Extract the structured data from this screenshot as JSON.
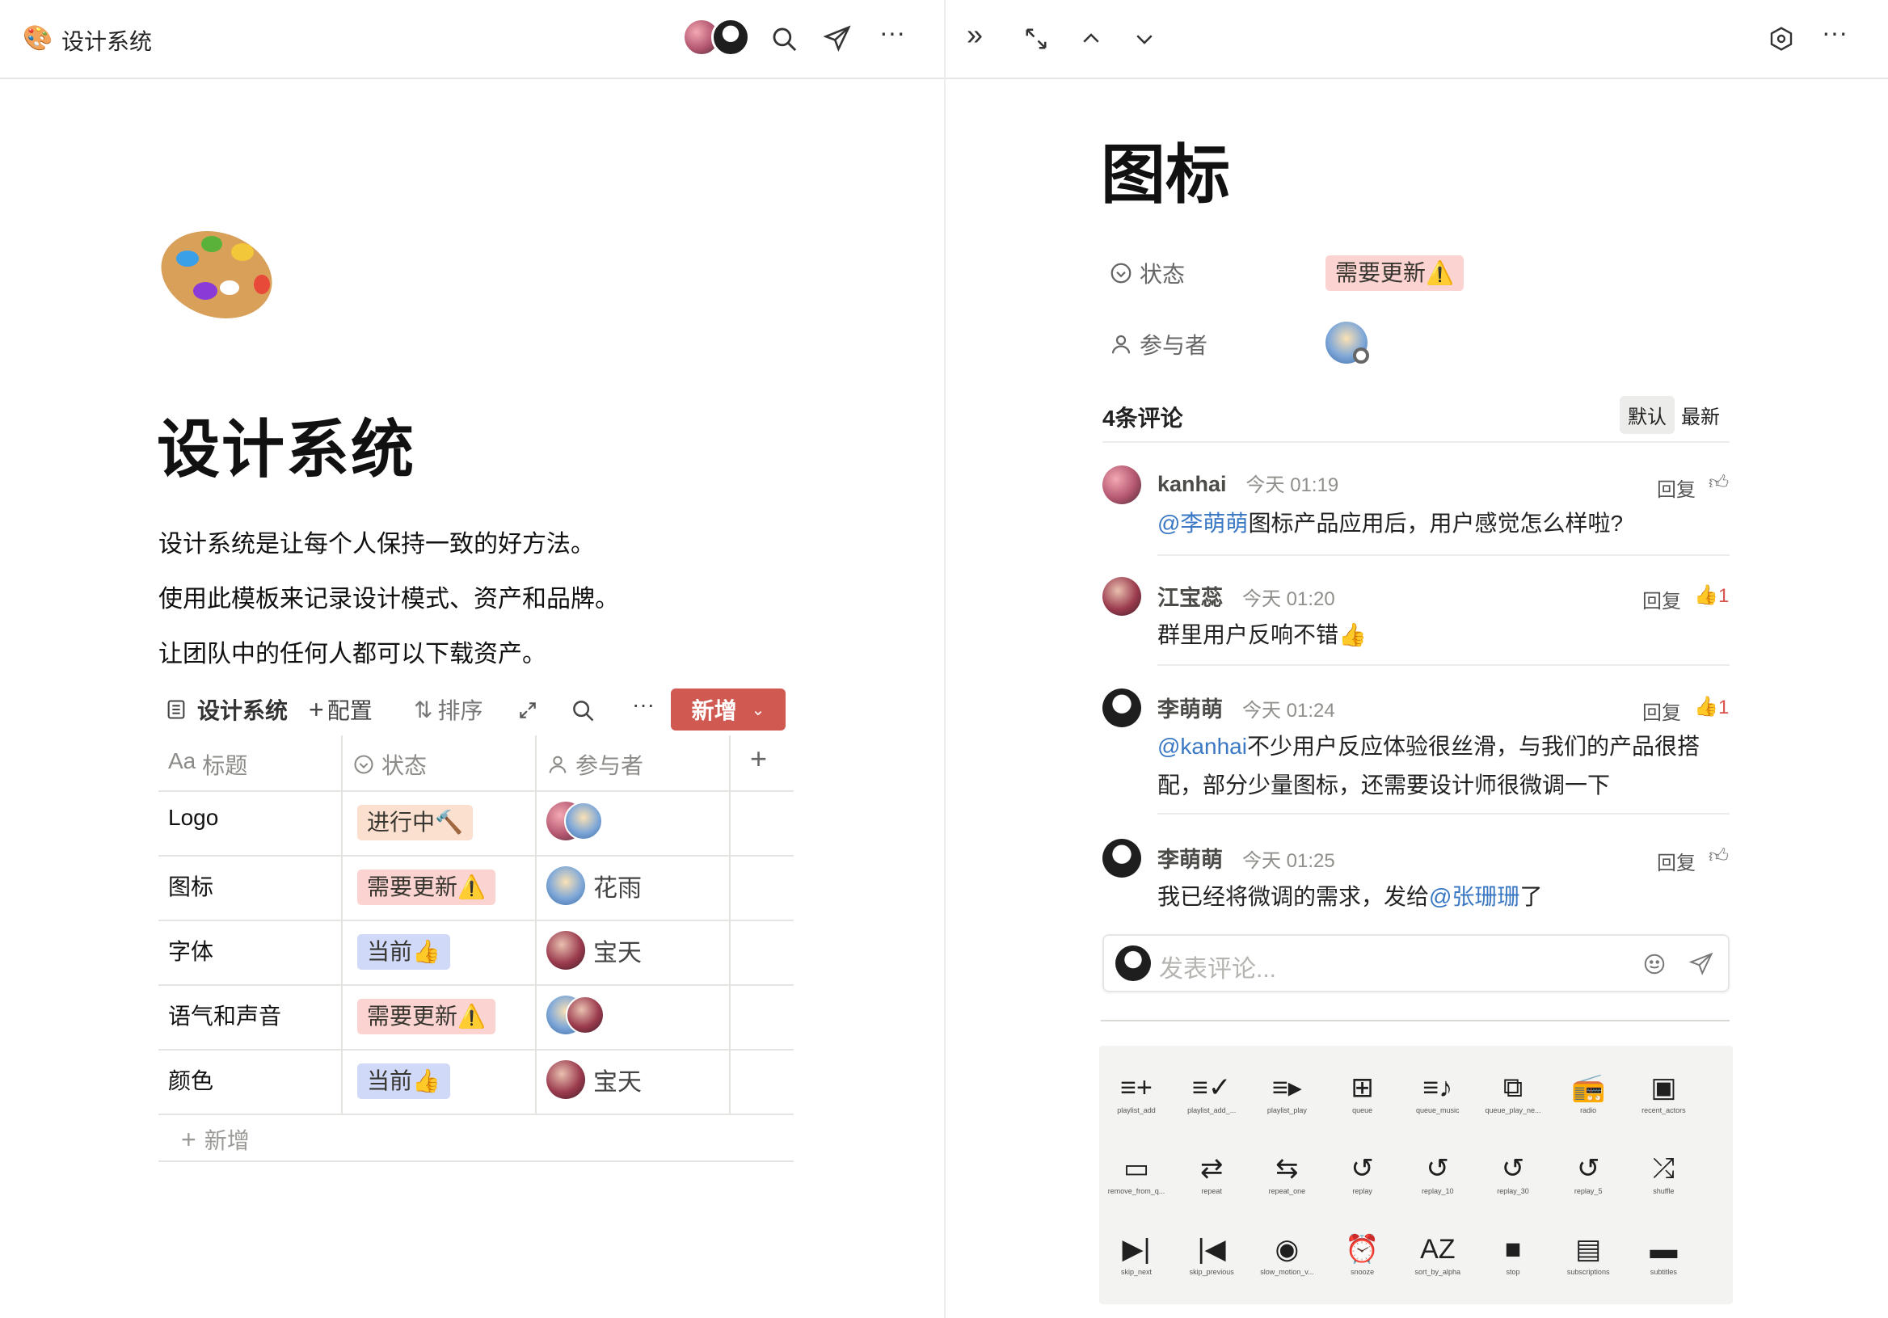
{
  "app": {
    "title": "设计系统"
  },
  "top_left": {
    "title": "设计系统"
  },
  "page": {
    "title": "设计系统",
    "paragraphs": [
      "设计系统是让每个人保持一致的好方法。",
      "使用此模板来记录设计模式、资产和品牌。",
      "让团队中的任何人都可以下载资产。"
    ]
  },
  "db": {
    "view_name": "设计系统",
    "config_label": "配置",
    "sort_label": "排序",
    "new_button": "新增",
    "columns": {
      "title": "标题",
      "title_prefix": "Aa",
      "status": "状态",
      "participants": "参与者"
    },
    "rows": [
      {
        "title": "Logo",
        "status": "进行中🔨",
        "status_color": "orange",
        "person": ""
      },
      {
        "title": "图标",
        "status": "需要更新⚠️",
        "status_color": "red",
        "person": "花雨"
      },
      {
        "title": "字体",
        "status": "当前👍",
        "status_color": "blue",
        "person": "宝天"
      },
      {
        "title": "语气和声音",
        "status": "需要更新⚠️",
        "status_color": "red",
        "person": ""
      },
      {
        "title": "颜色",
        "status": "当前👍",
        "status_color": "blue",
        "person": "宝天"
      }
    ],
    "add_row": "新增"
  },
  "detail": {
    "title": "图标",
    "props": {
      "status_label": "状态",
      "status_value": "需要更新⚠️",
      "participants_label": "参与者"
    },
    "comments_header": "4条评论",
    "sort_default": "默认",
    "sort_latest": "最新",
    "comments": [
      {
        "name": "kanhai",
        "time": "今天 01:19",
        "mention": "@李萌萌",
        "text": "图标产品应用后，用户感觉怎么样啦?",
        "reply": "回复",
        "likes": ""
      },
      {
        "name": "江宝蕊",
        "time": "今天 01:20",
        "mention": "",
        "text": "群里用户反响不错👍",
        "reply": "回复",
        "likes": "1"
      },
      {
        "name": "李萌萌",
        "time": "今天 01:24",
        "mention": "@kanhai",
        "text": "不少用户反应体验很丝滑，与我们的产品很搭",
        "text2": "配，部分少量图标，还需要设计师很微调一下",
        "reply": "回复",
        "likes": "1"
      },
      {
        "name": "李萌萌",
        "time": "今天 01:25",
        "mention": "",
        "text": "我已经将微调的需求，发给",
        "mention2": "@张珊珊",
        "text_after": "了",
        "reply": "回复",
        "likes": ""
      }
    ],
    "comment_placeholder": "发表评论..."
  },
  "icon_grid": [
    {
      "glyph": "≡+",
      "label": "playlist_add"
    },
    {
      "glyph": "≡✓",
      "label": "playlist_add_..."
    },
    {
      "glyph": "≡▸",
      "label": "playlist_play"
    },
    {
      "glyph": "⊞",
      "label": "queue"
    },
    {
      "glyph": "≡♪",
      "label": "queue_music"
    },
    {
      "glyph": "⧉",
      "label": "queue_play_ne..."
    },
    {
      "glyph": "📻",
      "label": "radio"
    },
    {
      "glyph": "▣",
      "label": "recent_actors"
    },
    {
      "glyph": "▭",
      "label": "remove_from_q..."
    },
    {
      "glyph": "⇄",
      "label": "repeat"
    },
    {
      "glyph": "⇆",
      "label": "repeat_one"
    },
    {
      "glyph": "↺",
      "label": "replay"
    },
    {
      "glyph": "↺",
      "label": "replay_10"
    },
    {
      "glyph": "↺",
      "label": "replay_30"
    },
    {
      "glyph": "↺",
      "label": "replay_5"
    },
    {
      "glyph": "⤮",
      "label": "shuffle"
    },
    {
      "glyph": "▶|",
      "label": "skip_next"
    },
    {
      "glyph": "|◀",
      "label": "skip_previous"
    },
    {
      "glyph": "◉",
      "label": "slow_motion_v..."
    },
    {
      "glyph": "⏰",
      "label": "snooze"
    },
    {
      "glyph": "AZ",
      "label": "sort_by_alpha"
    },
    {
      "glyph": "■",
      "label": "stop"
    },
    {
      "glyph": "▤",
      "label": "subscriptions"
    },
    {
      "glyph": "▬",
      "label": "subtitles"
    }
  ]
}
